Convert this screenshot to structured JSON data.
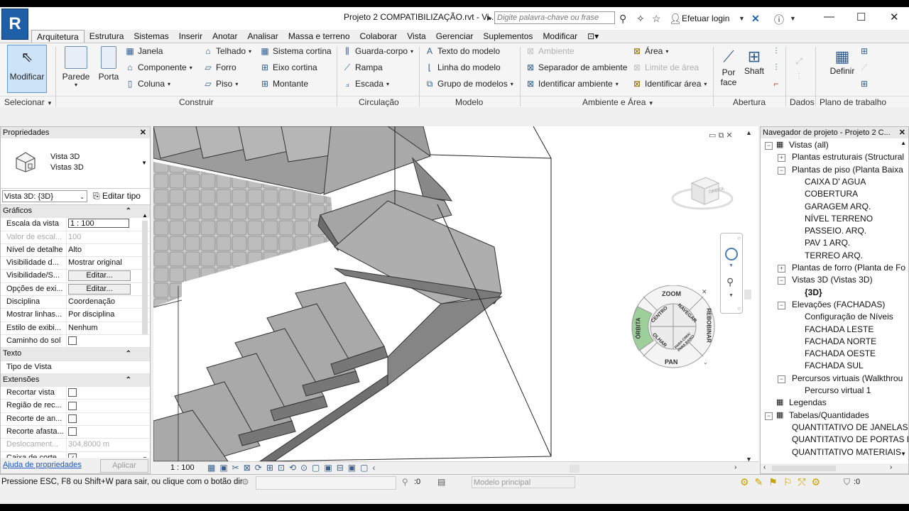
{
  "title": {
    "app_logo": "R",
    "window_title": "Projeto 2 COMPATIBILIZAÇÃO.rvt - Vi...",
    "search_placeholder": "Digite palavra-chave ou frase",
    "login_label": "Efetuar login"
  },
  "tabs": [
    "Arquitetura",
    "Estrutura",
    "Sistemas",
    "Inserir",
    "Anotar",
    "Analisar",
    "Massa e terreno",
    "Colaborar",
    "Vista",
    "Gerenciar",
    "Suplementos",
    "Modificar"
  ],
  "active_tab": "Arquitetura",
  "ribbon": {
    "modificar": "Modificar",
    "parede": "Parede",
    "porta": "Porta",
    "janela": "Janela",
    "componente": "Componente",
    "coluna": "Coluna",
    "telhado": "Telhado",
    "forro": "Forro",
    "piso": "Piso",
    "sistema_cortina": "Sistema cortina",
    "eixo_cortina": "Eixo cortina",
    "montante": "Montante",
    "guarda_corpo": "Guarda-corpo",
    "rampa": "Rampa",
    "escada": "Escada",
    "texto_modelo": "Texto do modelo",
    "linha_modelo": "Linha do modelo",
    "grupo_modelos": "Grupo de modelos",
    "ambiente": "Ambiente",
    "separador_ambiente": "Separador de ambiente",
    "identificar_ambiente": "Identificar ambiente",
    "area": "Área",
    "limite_area": "Limite de área",
    "identificar_area": "Identificar área",
    "por_face": "Por face",
    "shaft": "Shaft",
    "definir": "Definir",
    "groups": {
      "selecionar": "Selecionar",
      "construir": "Construir",
      "circulacao": "Circulação",
      "modelo": "Modelo",
      "ambiente_area": "Ambiente e Área",
      "abertura": "Abertura",
      "dados": "Dados",
      "plano_trabalho": "Plano de trabalho"
    }
  },
  "properties": {
    "header": "Propriedades",
    "type_line1": "Vista 3D",
    "type_line2": "Vistas 3D",
    "view_selector": "Vista 3D: {3D}",
    "edit_type": "Editar tipo",
    "sections": {
      "graficos": "Gráficos",
      "texto": "Texto",
      "extensoes": "Extensões"
    },
    "rows_graficos": [
      {
        "k": "Escala da vista",
        "v": "1 : 100",
        "kind": "input"
      },
      {
        "k": "Valor de escal...",
        "v": "100",
        "kind": "dim"
      },
      {
        "k": "Nível de detalhe",
        "v": "Alto",
        "kind": "text"
      },
      {
        "k": "Visibilidade d...",
        "v": "Mostrar original",
        "kind": "text"
      },
      {
        "k": "Visibilidade/S...",
        "v": "Editar...",
        "kind": "button"
      },
      {
        "k": "Opções de exi...",
        "v": "Editar...",
        "kind": "button"
      },
      {
        "k": "Disciplina",
        "v": "Coordenação",
        "kind": "text"
      },
      {
        "k": "Mostrar linhas...",
        "v": "Por disciplina",
        "kind": "text"
      },
      {
        "k": "Estilo de exibi...",
        "v": "Nenhum",
        "kind": "text"
      },
      {
        "k": "Caminho do sol",
        "v": "",
        "kind": "check"
      }
    ],
    "rows_texto": [
      {
        "k": "Tipo de Vista",
        "v": "",
        "kind": "text"
      }
    ],
    "rows_extensoes": [
      {
        "k": "Recortar vista",
        "v": "",
        "kind": "check"
      },
      {
        "k": "Região de rec...",
        "v": "",
        "kind": "check"
      },
      {
        "k": "Recorte de an...",
        "v": "",
        "kind": "check"
      },
      {
        "k": "Recorte afasta...",
        "v": "",
        "kind": "check"
      },
      {
        "k": "Deslocament...",
        "v": "304,8000 m",
        "kind": "dim"
      },
      {
        "k": "Caixa de corte",
        "v": "✓",
        "kind": "checked"
      }
    ],
    "help_link": "Ajuda de propriedades",
    "apply": "Aplicar"
  },
  "viewport": {
    "scale": "1 : 100",
    "viewcube_label": "ÓRBITA",
    "wheel": {
      "zoom": "ZOOM",
      "orbita": "ÓRBITA",
      "pan": "PAN",
      "rebobinar": "REBOBINAR",
      "centro": "CENTRO",
      "navegar": "NAVEGAR",
      "olhar": "OLHAR",
      "para_cima_baixo": "PARA CIMA/ PARA BAIXO"
    }
  },
  "navigator": {
    "header": "Navegador de projeto - Projeto 2 C...",
    "items": [
      {
        "t": "Vistas (all)",
        "lvl": 0,
        "exp": "−"
      },
      {
        "t": "Plantas estruturais (Structural",
        "lvl": 1,
        "exp": "+"
      },
      {
        "t": "Plantas de piso (Planta Baixa",
        "lvl": 1,
        "exp": "−"
      },
      {
        "t": "CAIXA D' AGUA",
        "lvl": 2
      },
      {
        "t": "COBERTURA",
        "lvl": 2
      },
      {
        "t": "GARAGEM ARQ.",
        "lvl": 2
      },
      {
        "t": "NÍVEL TERRENO",
        "lvl": 2
      },
      {
        "t": "PASSEIO. ARQ.",
        "lvl": 2
      },
      {
        "t": "PAV 1 ARQ.",
        "lvl": 2
      },
      {
        "t": "TERREO ARQ.",
        "lvl": 2
      },
      {
        "t": "Plantas de forro (Planta de Fo",
        "lvl": 1,
        "exp": "+"
      },
      {
        "t": "Vistas 3D (Vistas 3D)",
        "lvl": 1,
        "exp": "−"
      },
      {
        "t": "{3D}",
        "lvl": 2,
        "bold": true
      },
      {
        "t": "Elevações (FACHADAS)",
        "lvl": 1,
        "exp": "−"
      },
      {
        "t": "Configuração de Níveis",
        "lvl": 2
      },
      {
        "t": "FACHADA LESTE",
        "lvl": 2
      },
      {
        "t": "FACHADA NORTE",
        "lvl": 2
      },
      {
        "t": "FACHADA OESTE",
        "lvl": 2
      },
      {
        "t": "FACHADA SUL",
        "lvl": 2
      },
      {
        "t": "Percursos virtuais (Walkthrou",
        "lvl": 1,
        "exp": "−"
      },
      {
        "t": "Percurso virtual 1",
        "lvl": 2
      },
      {
        "t": "Legendas",
        "lvl": 0
      },
      {
        "t": "Tabelas/Quantidades",
        "lvl": 0,
        "exp": "−"
      },
      {
        "t": "QUANTITATIVO DE JANELAS",
        "lvl": 1
      },
      {
        "t": "QUANTITATIVO DE PORTAS E",
        "lvl": 1
      },
      {
        "t": "QUANTITATIVO MATERIAIS",
        "lvl": 1
      }
    ]
  },
  "status": {
    "message": "Pressione ESC, F8 ou Shift+W para sair, ou clique com o botão dir",
    "zero": ":0",
    "model": "Modelo principal",
    "filter_count": ":0"
  }
}
